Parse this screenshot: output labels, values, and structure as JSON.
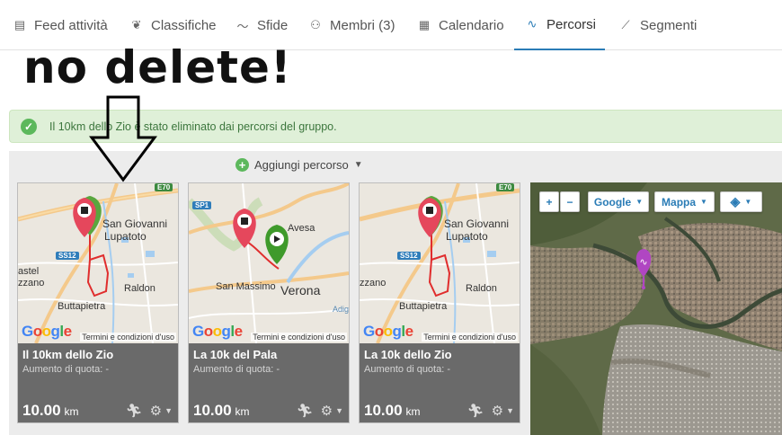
{
  "tabs": [
    {
      "label": "Feed attività",
      "icon": "feed-icon"
    },
    {
      "label": "Classifiche",
      "icon": "laurel-icon"
    },
    {
      "label": "Sfide",
      "icon": "challenge-icon"
    },
    {
      "label": "Membri (3)",
      "icon": "members-icon"
    },
    {
      "label": "Calendario",
      "icon": "calendar-icon"
    },
    {
      "label": "Percorsi",
      "icon": "route-icon",
      "active": true
    },
    {
      "label": "Segmenti",
      "icon": "segment-icon"
    }
  ],
  "annotation": {
    "text": "no delete!"
  },
  "alert": {
    "message": "Il 10km dello Zio è stato eliminato dai percorsi del gruppo."
  },
  "add_route": {
    "label": "Aggiungi percorso"
  },
  "routes": [
    {
      "name": "Il 10km dello Zio",
      "elevation": "Aumento di quota: -",
      "distance": "10.00",
      "unit": "km",
      "map_labels": [
        "San Giovanni",
        "Lupatoto",
        "Raldon",
        "Buttapietra",
        "astel",
        "zzano"
      ],
      "shields": [
        "E70",
        "SS12"
      ]
    },
    {
      "name": "La 10k del Pala",
      "elevation": "Aumento di quota: -",
      "distance": "10.00",
      "unit": "km",
      "map_labels": [
        "Avesa",
        "San Massimo",
        "Verona",
        "Adig"
      ],
      "shields": [
        "SP1"
      ]
    },
    {
      "name": "La 10k dello Zio",
      "elevation": "Aumento di quota: -",
      "distance": "10.00",
      "unit": "km",
      "map_labels": [
        "San Giovanni",
        "Lupatoto",
        "Raldon",
        "Buttapietra",
        "zzano"
      ],
      "shields": [
        "E70",
        "SS12"
      ]
    }
  ],
  "map_footer": {
    "logo": "Google",
    "terms": "Termini e condizioni d'uso"
  },
  "map_controls": {
    "zoom_in": "+",
    "zoom_out": "−",
    "provider": "Google",
    "type": "Mappa"
  }
}
